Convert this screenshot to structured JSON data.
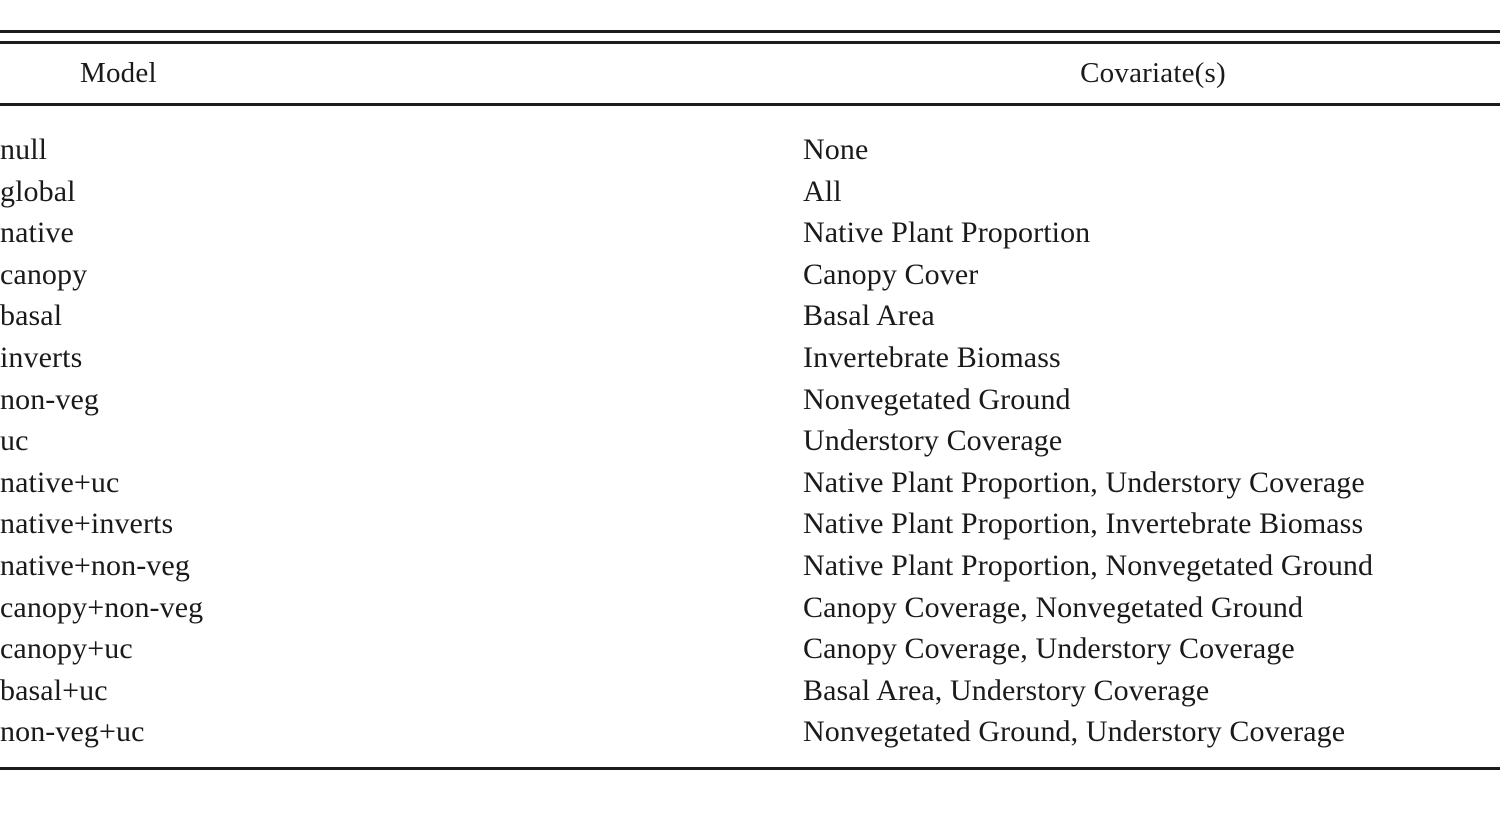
{
  "table": {
    "columns": {
      "model": "Model",
      "covariates": "Covariate(s)"
    },
    "rows": [
      {
        "model": "null",
        "covariates": "None"
      },
      {
        "model": "global",
        "covariates": "All"
      },
      {
        "model": "native",
        "covariates": "Native Plant Proportion"
      },
      {
        "model": "canopy",
        "covariates": "Canopy Cover"
      },
      {
        "model": "basal",
        "covariates": "Basal Area"
      },
      {
        "model": "inverts",
        "covariates": "Invertebrate Biomass"
      },
      {
        "model": "non-veg",
        "covariates": "Nonvegetated Ground"
      },
      {
        "model": "uc",
        "covariates": "Understory Coverage"
      },
      {
        "model": "native+uc",
        "covariates": "Native Plant Proportion, Understory Coverage"
      },
      {
        "model": "native+inverts",
        "covariates": "Native Plant Proportion, Invertebrate Biomass"
      },
      {
        "model": "native+non-veg",
        "covariates": "Native Plant Proportion, Nonvegetated Ground"
      },
      {
        "model": "canopy+non-veg",
        "covariates": "Canopy Coverage, Nonvegetated Ground"
      },
      {
        "model": "canopy+uc",
        "covariates": "Canopy Coverage, Understory Coverage"
      },
      {
        "model": "basal+uc",
        "covariates": "Basal Area, Understory Coverage"
      },
      {
        "model": "non-veg+uc",
        "covariates": "Nonvegetated Ground, Understory Coverage"
      }
    ]
  }
}
